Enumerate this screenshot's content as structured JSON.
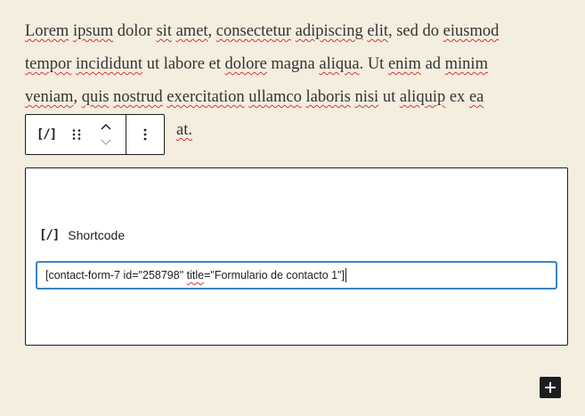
{
  "paragraph": {
    "line1": [
      {
        "t": "Lorem",
        "s": true
      },
      {
        "t": " ",
        "s": false
      },
      {
        "t": "ipsum",
        "s": true
      },
      {
        "t": " dolor ",
        "s": false
      },
      {
        "t": "sit",
        "s": true
      },
      {
        "t": " ",
        "s": false
      },
      {
        "t": "amet",
        "s": true
      },
      {
        "t": ", ",
        "s": false
      },
      {
        "t": "consectetur",
        "s": true
      },
      {
        "t": " ",
        "s": false
      },
      {
        "t": "adipiscing",
        "s": true
      },
      {
        "t": " ",
        "s": false
      },
      {
        "t": "elit",
        "s": true
      },
      {
        "t": ", sed do ",
        "s": false
      },
      {
        "t": "eiusmod",
        "s": true
      }
    ],
    "line2": [
      {
        "t": "tempor",
        "s": true
      },
      {
        "t": " ",
        "s": false
      },
      {
        "t": "incididunt",
        "s": true
      },
      {
        "t": " ut labore et ",
        "s": false
      },
      {
        "t": "dolore",
        "s": true
      },
      {
        "t": " magna ",
        "s": false
      },
      {
        "t": "aliqua",
        "s": true
      },
      {
        "t": ". Ut ",
        "s": false
      },
      {
        "t": "enim",
        "s": true
      },
      {
        "t": " ad ",
        "s": false
      },
      {
        "t": "minim",
        "s": true
      }
    ],
    "line3": [
      {
        "t": "veniam",
        "s": true
      },
      {
        "t": ", ",
        "s": false
      },
      {
        "t": "quis",
        "s": true
      },
      {
        "t": " ",
        "s": false
      },
      {
        "t": "nostrud",
        "s": true
      },
      {
        "t": " ",
        "s": false
      },
      {
        "t": "exercitation",
        "s": true
      },
      {
        "t": " ",
        "s": false
      },
      {
        "t": "ullamco",
        "s": true
      },
      {
        "t": " ",
        "s": false
      },
      {
        "t": "laboris",
        "s": true
      },
      {
        "t": " ",
        "s": false
      },
      {
        "t": "nisi",
        "s": true
      },
      {
        "t": " ut ",
        "s": false
      },
      {
        "t": "aliquip",
        "s": true
      },
      {
        "t": " ex ",
        "s": false
      },
      {
        "t": "ea",
        "s": true
      }
    ],
    "line4_visible_tail": "at."
  },
  "toolbar": {
    "block_type_glyph": "[/]",
    "block_type_icon": "shortcode-icon",
    "drag_icon": "drag-handle-icon",
    "move_up_icon": "chevron-up-icon",
    "move_down_icon": "chevron-down-icon",
    "options_icon": "more-vertical-icon"
  },
  "block": {
    "glyph": "[/]",
    "label": "Shortcode",
    "input_value_before": "[contact-form-7 id=\"258798\" ",
    "input_value_spell": "title",
    "input_value_after": "=\"Formulario de contacto 1\"]"
  },
  "inserter": {
    "icon": "plus-icon"
  },
  "colors": {
    "background": "#f4eee0",
    "text": "#333333",
    "border": "#1e1e1e",
    "focus": "#3a84c4",
    "spellcheck": "#d63638"
  }
}
